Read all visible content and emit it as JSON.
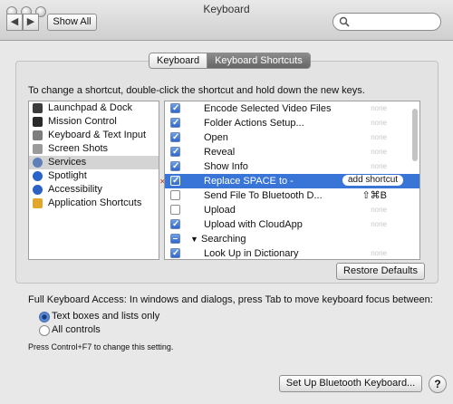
{
  "window": {
    "title": "Keyboard"
  },
  "toolbar": {
    "back_glyph": "◀",
    "forward_glyph": "▶",
    "show_all_label": "Show All",
    "search_value": ""
  },
  "tabs": [
    {
      "label": "Keyboard",
      "selected": false
    },
    {
      "label": "Keyboard Shortcuts",
      "selected": true
    }
  ],
  "instructions": "To change a shortcut, double-click the shortcut and hold down the new keys.",
  "categories": [
    {
      "label": "Launchpad & Dock",
      "icon": "launchpad-icon",
      "color": "#3b3b3b"
    },
    {
      "label": "Mission Control",
      "icon": "mission-control-icon",
      "color": "#2a2a2a"
    },
    {
      "label": "Keyboard & Text Input",
      "icon": "keyboard-icon",
      "color": "#7d7d7d"
    },
    {
      "label": "Screen Shots",
      "icon": "screenshot-icon",
      "color": "#9a9a9a"
    },
    {
      "label": "Services",
      "icon": "gear-icon",
      "color": "#5f7fb8",
      "selected": true
    },
    {
      "label": "Spotlight",
      "icon": "spotlight-icon",
      "color": "#2a63c9"
    },
    {
      "label": "Accessibility",
      "icon": "accessibility-icon",
      "color": "#2d62c4"
    },
    {
      "label": "Application Shortcuts",
      "icon": "app-shortcuts-icon",
      "color": "#e0a72a"
    }
  ],
  "services": [
    {
      "name": "Encode Selected Video Files",
      "checked": true,
      "shortcut": "none"
    },
    {
      "name": "Folder Actions Setup...",
      "checked": true,
      "shortcut": "none"
    },
    {
      "name": "Open",
      "checked": true,
      "shortcut": "none"
    },
    {
      "name": "Reveal",
      "checked": true,
      "shortcut": "none"
    },
    {
      "name": "Show Info",
      "checked": true,
      "shortcut": "none"
    },
    {
      "name": "Replace SPACE to -",
      "checked": true,
      "shortcut": "add shortcut",
      "selected": true
    },
    {
      "name": "Send File To Bluetooth D...",
      "checked": false,
      "shortcut": "⇧⌘B"
    },
    {
      "name": "Upload",
      "checked": false,
      "shortcut": "none"
    },
    {
      "name": "Upload with CloudApp",
      "checked": true,
      "shortcut": "none"
    },
    {
      "name": "Searching",
      "group": true
    },
    {
      "name": "Look Up in Dictionary",
      "checked": true,
      "shortcut": "none"
    }
  ],
  "buttons": {
    "restore_defaults": "Restore Defaults",
    "bluetooth_setup": "Set Up Bluetooth Keyboard...",
    "help": "?"
  },
  "keyboard_access": {
    "label": "Full Keyboard Access: In windows and dialogs, press Tab to move keyboard focus between:",
    "options": [
      {
        "label": "Text boxes and lists only",
        "selected": true
      },
      {
        "label": "All controls",
        "selected": false
      }
    ],
    "hint": "Press Control+F7 to change this setting."
  }
}
